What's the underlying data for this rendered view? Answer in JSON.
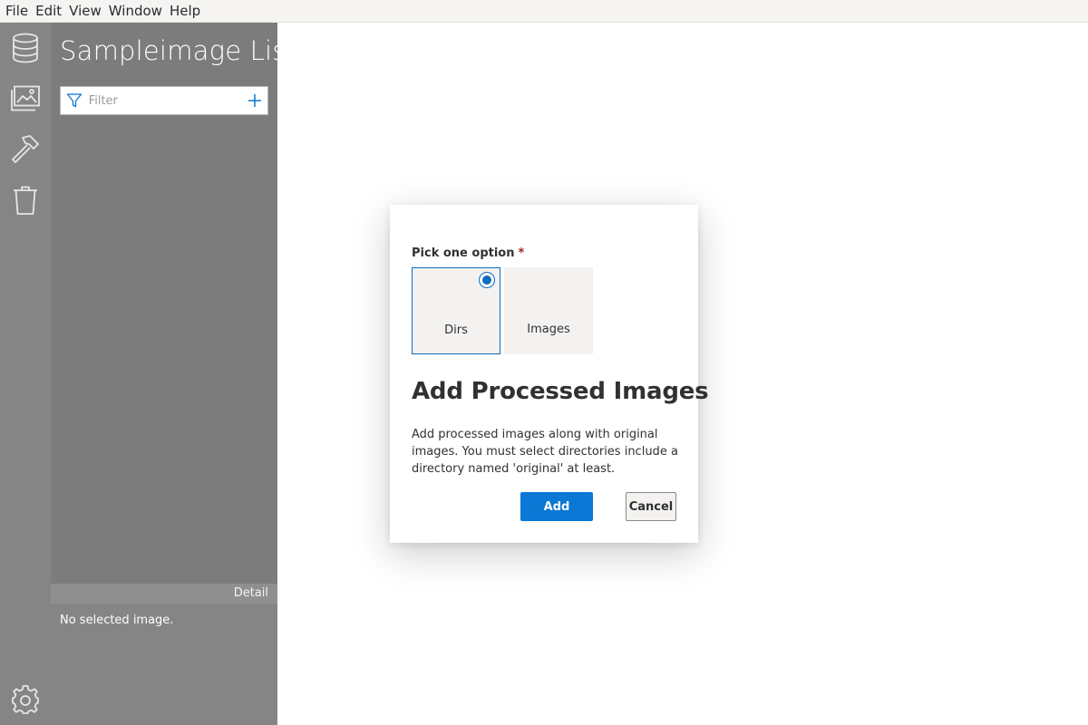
{
  "menubar": {
    "items": [
      "File",
      "Edit",
      "View",
      "Window",
      "Help"
    ]
  },
  "rail": {
    "icons": [
      "database-icon",
      "images-icon",
      "hammer-icon",
      "trash-icon",
      "gear-icon"
    ]
  },
  "panel": {
    "title": "Sampleimage List",
    "filter": {
      "placeholder": "Filter",
      "value": ""
    },
    "detail_label": "Detail",
    "detail_empty": "No selected image."
  },
  "dialog": {
    "pick_label": "Pick one option",
    "required_mark": "*",
    "options": [
      {
        "label": "Dirs",
        "selected": true
      },
      {
        "label": "Images",
        "selected": false
      }
    ],
    "title": "Add Processed Images",
    "description": "Add processed images along with original images. You must select directories include a directory named 'original' at least.",
    "add_label": "Add",
    "cancel_label": "Cancel"
  },
  "colors": {
    "accent": "#0a78d4",
    "rail_bg": "#858585",
    "panel_bg": "#7c7c7c",
    "required": "#a4262c"
  }
}
